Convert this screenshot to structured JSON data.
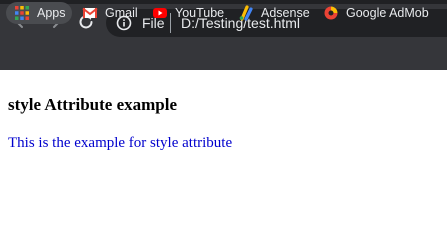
{
  "browser": {
    "nav": {
      "back_icon": "back-arrow-icon",
      "forward_icon": "forward-arrow-icon",
      "reload_icon": "reload-icon"
    },
    "omnibox": {
      "scheme_label": "File",
      "url": "D:/Testing/test.html",
      "info_icon": "info-icon"
    }
  },
  "bookmarks": [
    {
      "label": "Apps",
      "icon": "apps-grid-icon"
    },
    {
      "label": "Gmail",
      "icon": "gmail-icon"
    },
    {
      "label": "YouTube",
      "icon": "youtube-icon"
    },
    {
      "label": "Adsense",
      "icon": "adsense-icon"
    },
    {
      "label": "Google AdMob",
      "icon": "admob-icon"
    }
  ],
  "page": {
    "heading": "style Attribute example",
    "paragraph": "This is the example for style attribute",
    "paragraph_color": "#0000cd"
  }
}
